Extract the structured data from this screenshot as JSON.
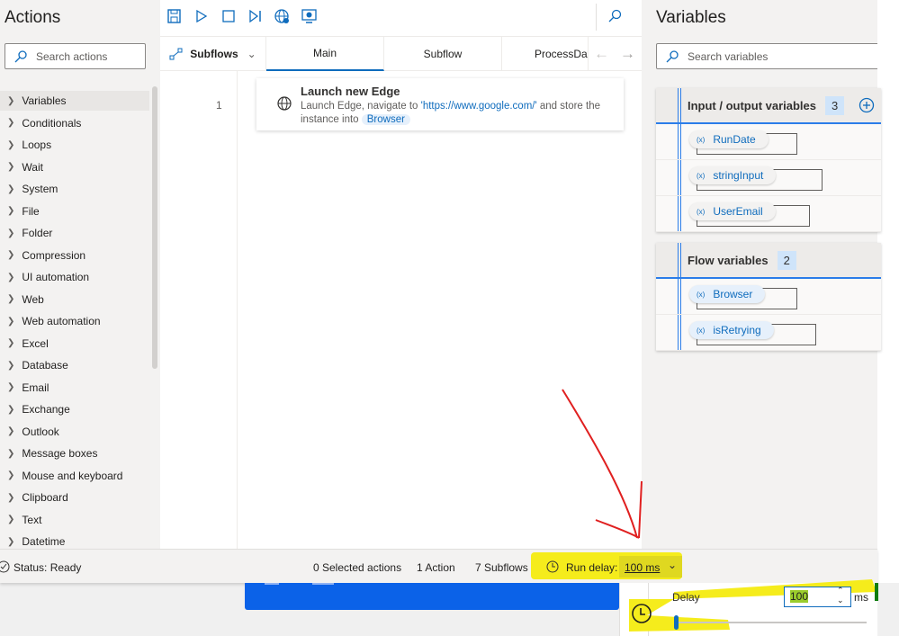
{
  "actions": {
    "title": "Actions",
    "search_placeholder": "Search actions",
    "items": [
      "Variables",
      "Conditionals",
      "Loops",
      "Wait",
      "System",
      "File",
      "Folder",
      "Compression",
      "UI automation",
      "Web",
      "Web automation",
      "Excel",
      "Database",
      "Email",
      "Exchange",
      "Outlook",
      "Message boxes",
      "Mouse and keyboard",
      "Clipboard",
      "Text",
      "Datetime"
    ]
  },
  "toolbar": {
    "icons": [
      "save-icon",
      "run-icon",
      "stop-icon",
      "run-next-icon",
      "web-recorder-icon",
      "desktop-recorder-icon",
      "search-icon"
    ]
  },
  "tabs": {
    "subflows_label": "Subflows",
    "items": [
      "Main",
      "Subflow",
      "ProcessData"
    ],
    "active": "Main"
  },
  "flow": {
    "steps": [
      {
        "number": "1",
        "title": "Launch new Edge",
        "desc_prefix": "Launch Edge, navigate to ",
        "url": "'https://www.google.com/'",
        "desc_mid": " and store the instance into ",
        "variable": "Browser"
      }
    ]
  },
  "variables": {
    "title": "Variables",
    "search_placeholder": "Search variables",
    "io": {
      "label": "Input / output variables",
      "count": "3",
      "items": [
        "RunDate",
        "stringInput",
        "UserEmail"
      ]
    },
    "flow": {
      "label": "Flow variables",
      "count": "2",
      "items": [
        "Browser",
        "isRetrying"
      ]
    }
  },
  "status": {
    "status": "Status: Ready",
    "selected": "0 Selected actions",
    "actions": "1 Action",
    "subflows": "7 Subflows",
    "run_delay_label": "Run delay:",
    "run_delay_value": "100 ms"
  },
  "delay_popup": {
    "label": "Delay",
    "value": "100",
    "unit": "ms",
    "slider_fraction": 0.0
  },
  "colors": {
    "accent": "#0f6cbd",
    "highlight": "#ffff00",
    "annotation_arrow": "#e02020"
  }
}
